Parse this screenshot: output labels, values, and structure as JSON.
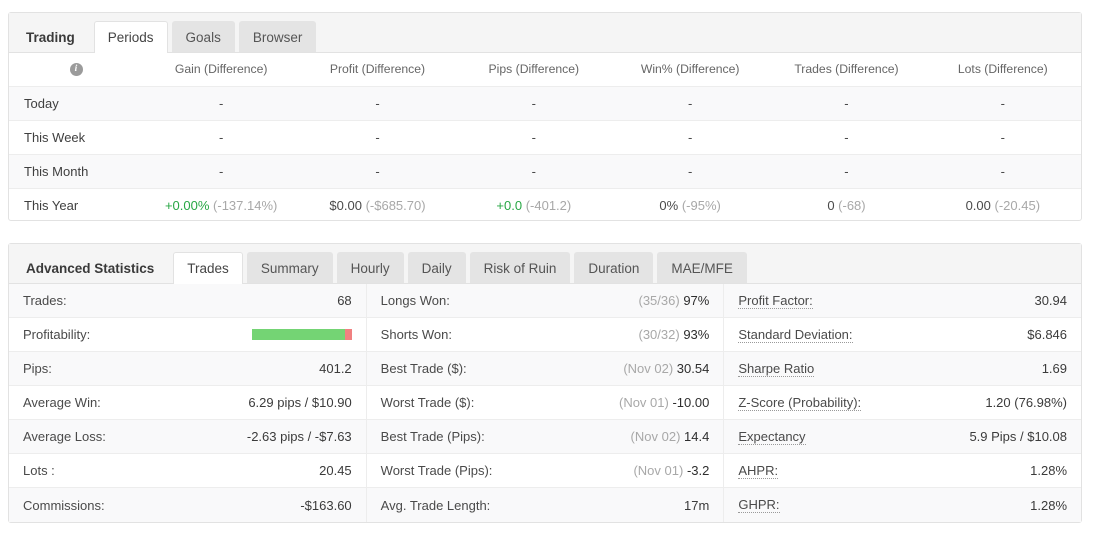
{
  "periods_panel": {
    "tabs": [
      {
        "label": "Trading",
        "state": "title"
      },
      {
        "label": "Periods",
        "state": "active"
      },
      {
        "label": "Goals",
        "state": "inactive"
      },
      {
        "label": "Browser",
        "state": "inactive"
      }
    ],
    "info_icon": "info-icon",
    "info_glyph": "i",
    "columns": [
      "Gain (Difference)",
      "Profit (Difference)",
      "Pips (Difference)",
      "Win% (Difference)",
      "Trades (Difference)",
      "Lots (Difference)"
    ],
    "rows": [
      {
        "label": "Today",
        "cells": [
          {
            "main": "-",
            "diff": ""
          },
          {
            "main": "-",
            "diff": ""
          },
          {
            "main": "-",
            "diff": ""
          },
          {
            "main": "-",
            "diff": ""
          },
          {
            "main": "-",
            "diff": ""
          },
          {
            "main": "-",
            "diff": ""
          }
        ]
      },
      {
        "label": "This Week",
        "cells": [
          {
            "main": "-",
            "diff": ""
          },
          {
            "main": "-",
            "diff": ""
          },
          {
            "main": "-",
            "diff": ""
          },
          {
            "main": "-",
            "diff": ""
          },
          {
            "main": "-",
            "diff": ""
          },
          {
            "main": "-",
            "diff": ""
          }
        ]
      },
      {
        "label": "This Month",
        "cells": [
          {
            "main": "-",
            "diff": ""
          },
          {
            "main": "-",
            "diff": ""
          },
          {
            "main": "-",
            "diff": ""
          },
          {
            "main": "-",
            "diff": ""
          },
          {
            "main": "-",
            "diff": ""
          },
          {
            "main": "-",
            "diff": ""
          }
        ]
      },
      {
        "label": "This Year",
        "cells": [
          {
            "main": "+0.00%",
            "diff": "(-137.14%)",
            "positive": true
          },
          {
            "main": "$0.00",
            "diff": "(-$685.70)",
            "positive": false
          },
          {
            "main": "+0.0",
            "diff": "(-401.2)",
            "positive": true
          },
          {
            "main": "0%",
            "diff": "(-95%)",
            "positive": false
          },
          {
            "main": "0",
            "diff": "(-68)",
            "positive": false
          },
          {
            "main": "0.00",
            "diff": "(-20.45)",
            "positive": false
          }
        ]
      }
    ]
  },
  "stats_panel": {
    "tabs": [
      {
        "label": "Advanced Statistics",
        "state": "title"
      },
      {
        "label": "Trades",
        "state": "active"
      },
      {
        "label": "Summary",
        "state": "inactive"
      },
      {
        "label": "Hourly",
        "state": "inactive"
      },
      {
        "label": "Daily",
        "state": "inactive"
      },
      {
        "label": "Risk of Ruin",
        "state": "inactive"
      },
      {
        "label": "Duration",
        "state": "inactive"
      },
      {
        "label": "MAE/MFE",
        "state": "inactive"
      }
    ],
    "columns": [
      [
        {
          "label": "Trades:",
          "value": "68",
          "tip": false
        },
        {
          "label": "Profitability:",
          "bar": {
            "win_pct": 93,
            "loss_pct": 7,
            "win_color": "#74d474",
            "loss_color": "#f08080"
          },
          "tip": false
        },
        {
          "label": "Pips:",
          "value": "401.2",
          "tip": false
        },
        {
          "label": "Average Win:",
          "value": "6.29 pips / $10.90",
          "tip": false
        },
        {
          "label": "Average Loss:",
          "value": "-2.63 pips / -$7.63",
          "tip": false
        },
        {
          "label": "Lots :",
          "value": "20.45",
          "tip": false
        },
        {
          "label": "Commissions:",
          "value": "-$163.60",
          "tip": false
        }
      ],
      [
        {
          "label": "Longs Won:",
          "muted": "(35/36)",
          "value": "97%",
          "tip": false
        },
        {
          "label": "Shorts Won:",
          "muted": "(30/32)",
          "value": "93%",
          "tip": false
        },
        {
          "label": "Best Trade ($):",
          "muted": "(Nov 02)",
          "value": "30.54",
          "tip": false
        },
        {
          "label": "Worst Trade ($):",
          "muted": "(Nov 01)",
          "value": "-10.00",
          "tip": false
        },
        {
          "label": "Best Trade (Pips):",
          "muted": "(Nov 02)",
          "value": "14.4",
          "tip": false
        },
        {
          "label": "Worst Trade (Pips):",
          "muted": "(Nov 01)",
          "value": "-3.2",
          "tip": false
        },
        {
          "label": "Avg. Trade Length:",
          "value": "17m",
          "tip": false
        }
      ],
      [
        {
          "label": "Profit Factor:",
          "value": "30.94",
          "tip": true
        },
        {
          "label": "Standard Deviation:",
          "value": "$6.846",
          "tip": true
        },
        {
          "label": "Sharpe Ratio",
          "value": "1.69",
          "tip": true
        },
        {
          "label": "Z-Score (Probability):",
          "value": "1.20 (76.98%)",
          "tip": true
        },
        {
          "label": "Expectancy",
          "value": "5.9 Pips / $10.08",
          "tip": true
        },
        {
          "label": "AHPR:",
          "value": "1.28%",
          "tip": true
        },
        {
          "label": "GHPR:",
          "value": "1.28%",
          "tip": true
        }
      ]
    ]
  },
  "colors": {
    "positive": "#28a745",
    "difference": "#a8a8a8",
    "panel_border": "#e2e2e2",
    "row_alt": "#f9f9fa",
    "tab_inactive": "#e4e4e4",
    "tabstrip_bg": "#f5f5f5",
    "profit_green": "#74d474",
    "loss_red": "#f08080"
  }
}
